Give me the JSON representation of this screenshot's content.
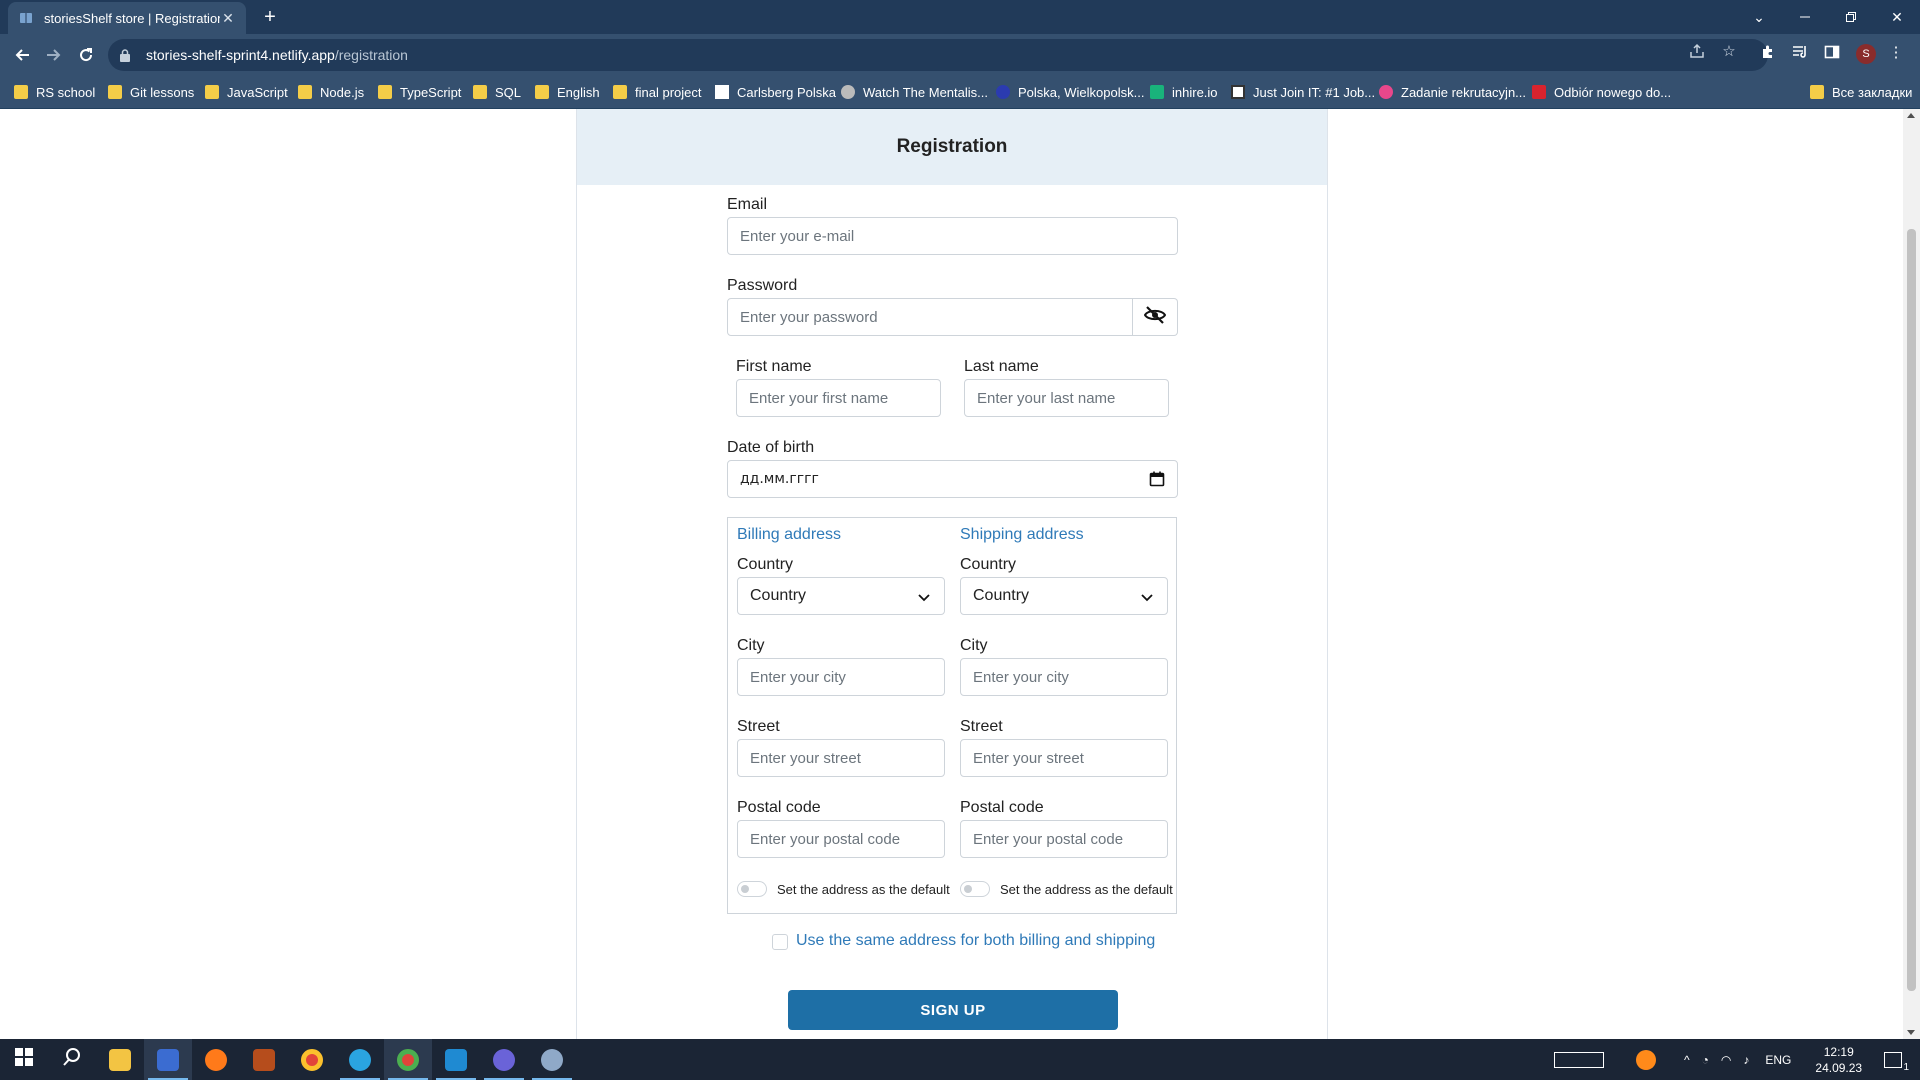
{
  "browser": {
    "tab_title": "storiesShelf store | Registration",
    "url_host": "stories-shelf-sprint4.netlify.app",
    "url_path": "/registration",
    "profile_initial": "S",
    "bookmarks": [
      {
        "label": "RS school",
        "icon": "folder-icon"
      },
      {
        "label": "Git lessons",
        "icon": "folder-icon"
      },
      {
        "label": "JavaScript",
        "icon": "folder-icon"
      },
      {
        "label": "Node.js",
        "icon": "folder-icon"
      },
      {
        "label": "TypeScript",
        "icon": "folder-icon"
      },
      {
        "label": "SQL",
        "icon": "folder-icon"
      },
      {
        "label": "English",
        "icon": "folder-icon"
      },
      {
        "label": "final project",
        "icon": "folder-icon"
      },
      {
        "label": "Carlsberg Polska",
        "icon": "page-icon"
      },
      {
        "label": "Watch The Mentalis...",
        "icon": "site-icon"
      },
      {
        "label": "Polska, Wielkopolsk...",
        "icon": "site-icon"
      },
      {
        "label": "inhire.io",
        "icon": "site-icon"
      },
      {
        "label": "Just Join IT: #1 Job...",
        "icon": "site-icon"
      },
      {
        "label": "Zadanie rekrutacyjn...",
        "icon": "site-icon"
      },
      {
        "label": "Odbiór nowego do...",
        "icon": "site-icon"
      }
    ],
    "all_bookmarks": "Все закладки"
  },
  "form": {
    "title": "Registration",
    "email_label": "Email",
    "email_placeholder": "Enter your e-mail",
    "password_label": "Password",
    "password_placeholder": "Enter your password",
    "first_name_label": "First name",
    "first_name_placeholder": "Enter your first name",
    "last_name_label": "Last name",
    "last_name_placeholder": "Enter your last name",
    "dob_label": "Date of birth",
    "dob_value": "дд.мм.гггг",
    "billing": {
      "title": "Billing address",
      "country_label": "Country",
      "country_value": "Country",
      "city_label": "City",
      "city_placeholder": "Enter your city",
      "street_label": "Street",
      "street_placeholder": "Enter your street",
      "postal_label": "Postal code",
      "postal_placeholder": "Enter your postal code",
      "default_label": "Set the address as the default"
    },
    "shipping": {
      "title": "Shipping address",
      "country_label": "Country",
      "country_value": "Country",
      "city_label": "City",
      "city_placeholder": "Enter your city",
      "street_label": "Street",
      "street_placeholder": "Enter your street",
      "postal_label": "Postal code",
      "postal_placeholder": "Enter your postal code",
      "default_label": "Set the address as the default"
    },
    "same_address_label": "Use the same address for both billing and shipping",
    "submit_label": "SIGN UP"
  },
  "taskbar": {
    "lang": "ENG",
    "time": "12:19",
    "date": "24.09.23",
    "notification_count": "1"
  },
  "colors": {
    "accent": "#2f7ab8",
    "button": "#1e6fa6",
    "header_bg": "#e6eff6",
    "chrome_dark": "#213a59",
    "chrome_light": "#35506f"
  }
}
